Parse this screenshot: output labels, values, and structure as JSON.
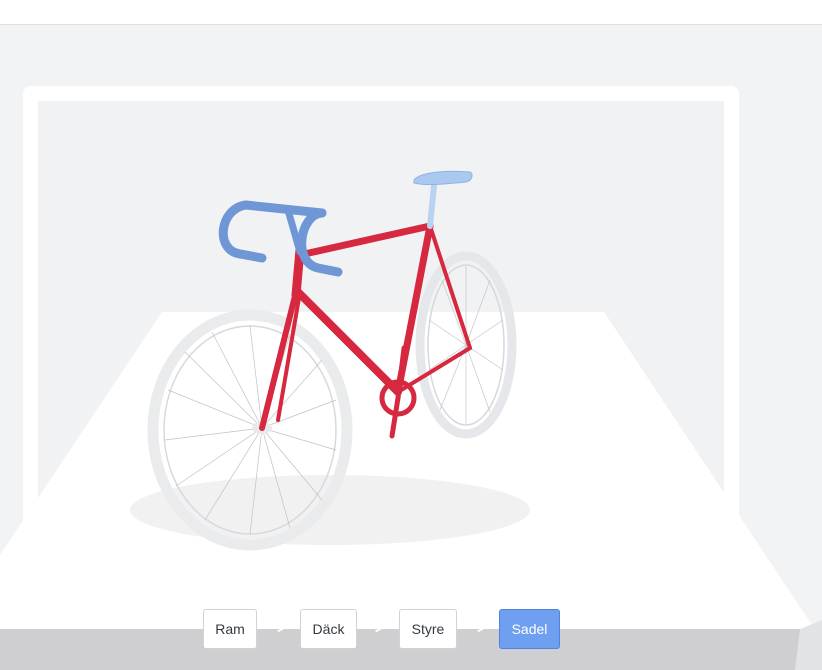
{
  "steps": [
    {
      "label": "Ram"
    },
    {
      "label": "Däck"
    },
    {
      "label": "Styre"
    },
    {
      "label": "Sadel",
      "active": true
    }
  ],
  "colors": {
    "frame": "#d6283e",
    "handlebar": "#6f97d6",
    "saddle": "#a9c9f0",
    "tires": "#e9eaec",
    "active_step": "#6f9ff0"
  }
}
